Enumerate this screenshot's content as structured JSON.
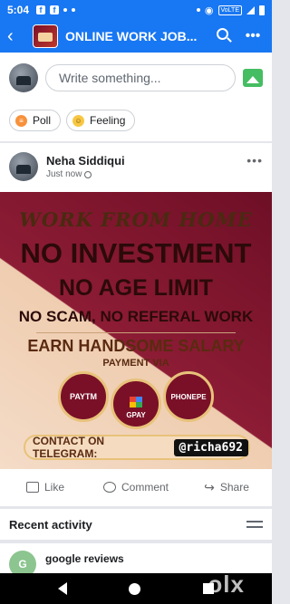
{
  "status_bar": {
    "time": "5:04",
    "network_badge": "VoLTE"
  },
  "header": {
    "title": "ONLINE WORK JOB...",
    "back_icon": "arrow-left-icon",
    "search_icon": "search-icon",
    "more_icon": "more-icon",
    "more_glyph": "•••"
  },
  "composer": {
    "placeholder": "Write something...",
    "chips": [
      {
        "label": "Poll",
        "icon": "poll-icon"
      },
      {
        "label": "Feeling",
        "icon": "feeling-icon"
      }
    ]
  },
  "post": {
    "author": "Neha Siddiqui",
    "time": "Just now",
    "more_glyph": "•••",
    "banner": {
      "line1": "WORK FROM HOME",
      "line2": "NO INVESTMENT",
      "line3": "NO AGE LIMIT",
      "line4": "NO SCAM, NO REFERAL WORK",
      "line5": "EARN HANDSOME SALARY",
      "line6": "PAYMENT VIA",
      "payments": [
        "PAYTM",
        "GPAY",
        "PHONEPE"
      ],
      "contact_label": "CONTACT ON TELEGRAM:",
      "contact_handle": "@richa692"
    },
    "actions": [
      {
        "label": "Like",
        "icon": "like-icon"
      },
      {
        "label": "Comment",
        "icon": "comment-icon"
      },
      {
        "label": "Share",
        "icon": "share-icon"
      }
    ]
  },
  "recent_activity": {
    "title": "Recent activity",
    "item_name": "google reviews",
    "item_initial": "G"
  },
  "watermark": "olx",
  "colors": {
    "brand": "#1877f2",
    "banner_red": "#7a1028",
    "banner_cream": "#f4dcc8"
  }
}
